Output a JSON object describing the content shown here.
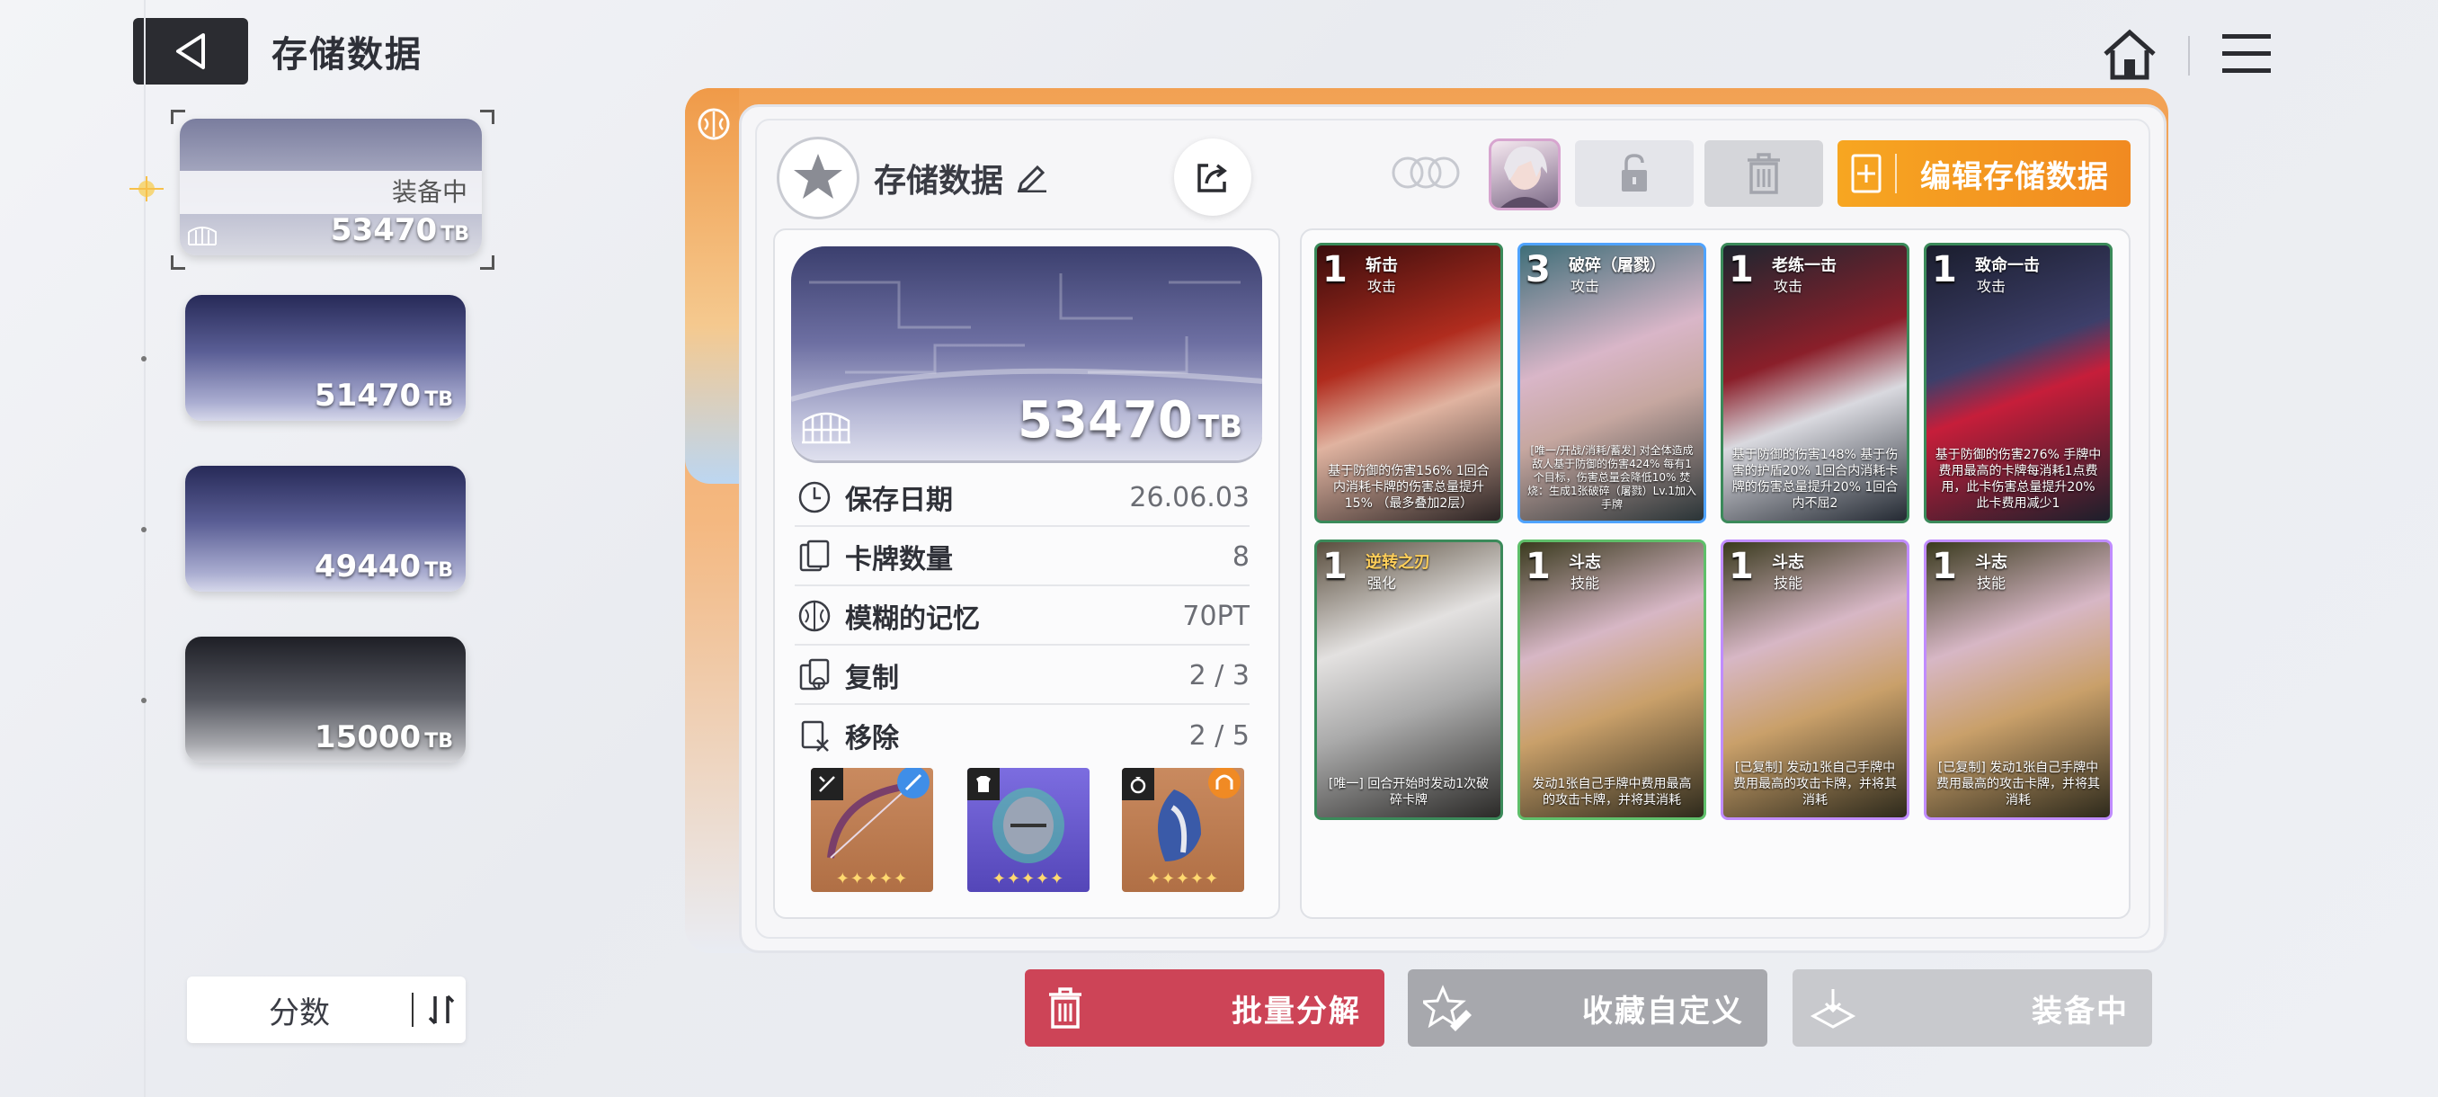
{
  "header": {
    "title": "存储数据"
  },
  "save_list": [
    {
      "value": "53470",
      "unit": "TB",
      "status": "装备中"
    },
    {
      "value": "51470",
      "unit": "TB"
    },
    {
      "value": "49440",
      "unit": "TB"
    },
    {
      "value": "15000",
      "unit": "TB"
    }
  ],
  "sort": {
    "label": "分数"
  },
  "panel": {
    "name": "存储数据",
    "edit_label": "编辑存储数据",
    "banner_value": "53470",
    "banner_unit": "TB",
    "stats": [
      {
        "label": "保存日期",
        "value": "26.06.03",
        "icon": "clock-icon"
      },
      {
        "label": "卡牌数量",
        "value": "8",
        "icon": "cards-icon"
      },
      {
        "label": "模糊的记忆",
        "value": "70PT",
        "icon": "brain-icon"
      },
      {
        "label": "复制",
        "value": "2 / 3",
        "icon": "copy-icon"
      },
      {
        "label": "移除",
        "value": "2 / 5",
        "icon": "remove-icon"
      }
    ]
  },
  "cards": [
    {
      "cost": "1",
      "name": "斩击",
      "type": "攻击",
      "desc": "基于防御的伤害156% 1回合内消耗卡牌的伤害总量提升15% （最多叠加2层）"
    },
    {
      "cost": "3",
      "name": "破碎（屠戮）",
      "type": "攻击",
      "desc": "[唯一/开战/消耗/蓄发] 对全体造成敌人基于防御的伤害424% 每有1个目标，伤害总量会降低10% 焚烧：生成1张破碎（屠戮）Lv.1加入手牌"
    },
    {
      "cost": "1",
      "name": "老练一击",
      "type": "攻击",
      "desc": "基于防御的伤害148% 基于伤害的护盾20% 1回合内消耗卡牌的伤害总量提升20% 1回合内不屈2"
    },
    {
      "cost": "1",
      "name": "致命一击",
      "type": "攻击",
      "desc": "基于防御的伤害276% 手牌中费用最高的卡牌每消耗1点费用，此卡伤害总量提升20% 此卡费用减少1"
    },
    {
      "cost": "1",
      "name": "逆转之刃",
      "type": "强化",
      "desc": "[唯一] 回合开始时发动1次破碎卡牌"
    },
    {
      "cost": "1",
      "name": "斗志",
      "type": "技能",
      "desc": "发动1张自己手牌中费用最高的攻击卡牌，并将其消耗"
    },
    {
      "cost": "1",
      "name": "斗志",
      "type": "技能",
      "desc": "[已复制] 发动1张自己手牌中费用最高的攻击卡牌，并将其消耗"
    },
    {
      "cost": "1",
      "name": "斗志",
      "type": "技能",
      "desc": "[已复制] 发动1张自己手牌中费用最高的攻击卡牌，并将其消耗"
    }
  ],
  "equipment": [
    {
      "name": "bow",
      "stars": "✦✦✦✦✦",
      "tag_icon": "sword-icon"
    },
    {
      "name": "helmet",
      "stars": "✦✦✦✦✦",
      "tag_icon": "armor-icon"
    },
    {
      "name": "mask",
      "stars": "✦✦✦✦✦",
      "tag_icon": "ring-icon"
    }
  ],
  "buttons": {
    "dismantle": "批量分解",
    "favorite": "收藏自定义",
    "equipped": "装备中"
  },
  "colors": {
    "accent_orange": "#f18a21",
    "danger_red": "#cd4457",
    "gray_button": "#a7a8ad"
  }
}
